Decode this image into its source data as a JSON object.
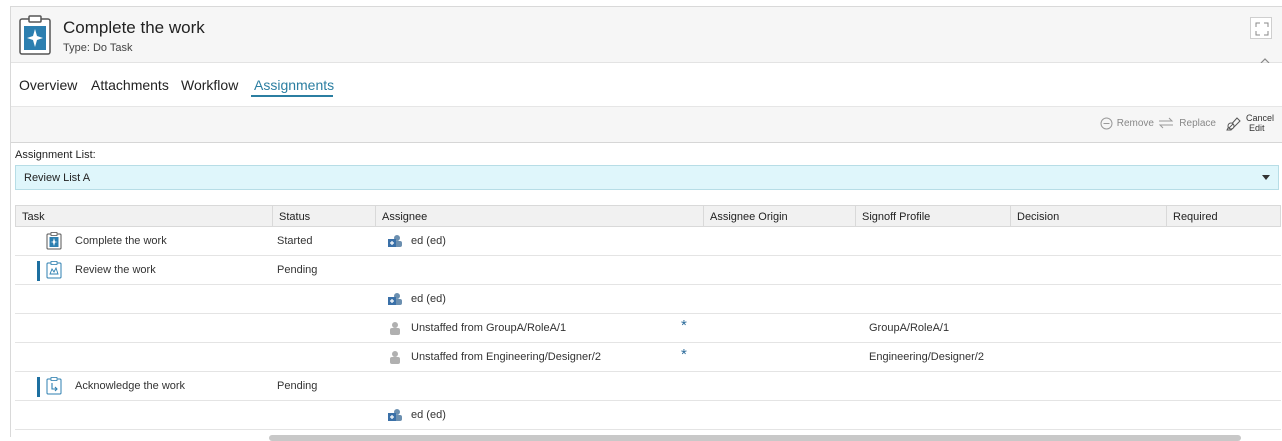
{
  "header": {
    "title": "Complete the work",
    "type_label": "Type: Do Task",
    "icon": "do-task-icon",
    "maximize_icon": "maximize-icon",
    "collapse_icon": "chevron-up-icon"
  },
  "tabs": [
    {
      "label": "Overview",
      "active": false
    },
    {
      "label": "Attachments",
      "active": false
    },
    {
      "label": "Workflow",
      "active": false
    },
    {
      "label": "Assignments",
      "active": true
    }
  ],
  "toolbar": {
    "remove_label": "Remove",
    "replace_label": "Replace",
    "cancel_label_line1": "Cancel",
    "cancel_label_line2": "Edit"
  },
  "assignment": {
    "label": "Assignment List:",
    "selected": "Review List A"
  },
  "table": {
    "columns": [
      "Task",
      "Status",
      "Assignee",
      "Assignee Origin",
      "Signoff Profile",
      "Decision",
      "Required"
    ],
    "rows": [
      {
        "task": "Complete the work",
        "task_icon": "do-task-icon",
        "bar": false,
        "status": "Started",
        "assignee": "ed (ed)",
        "assignee_icon": "user-group-icon",
        "star": "",
        "signoff": ""
      },
      {
        "task": "Review the work",
        "task_icon": "review-task-icon",
        "bar": true,
        "status": "Pending",
        "assignee": "",
        "assignee_icon": "",
        "star": "",
        "signoff": ""
      },
      {
        "task": "",
        "task_icon": "",
        "bar": false,
        "status": "",
        "assignee": "ed (ed)",
        "assignee_icon": "user-group-icon",
        "star": "",
        "signoff": ""
      },
      {
        "task": "",
        "task_icon": "",
        "bar": false,
        "status": "",
        "assignee": "Unstaffed from GroupA/RoleA/1",
        "assignee_icon": "unstaffed-user-icon",
        "star": "*",
        "signoff": "GroupA/RoleA/1"
      },
      {
        "task": "",
        "task_icon": "",
        "bar": false,
        "status": "",
        "assignee": "Unstaffed from Engineering/Designer/2",
        "assignee_icon": "unstaffed-user-icon",
        "star": "*",
        "signoff": "Engineering/Designer/2"
      },
      {
        "task": "Acknowledge the work",
        "task_icon": "acknowledge-task-icon",
        "bar": true,
        "status": "Pending",
        "assignee": "",
        "assignee_icon": "",
        "star": "",
        "signoff": ""
      },
      {
        "task": "",
        "task_icon": "",
        "bar": false,
        "status": "",
        "assignee": "ed (ed)",
        "assignee_icon": "user-group-icon",
        "star": "",
        "signoff": ""
      }
    ]
  },
  "colors": {
    "accent": "#2b7ea1",
    "dropdown_bg": "#dff6fb",
    "task_bar": "#1d6fa0"
  }
}
